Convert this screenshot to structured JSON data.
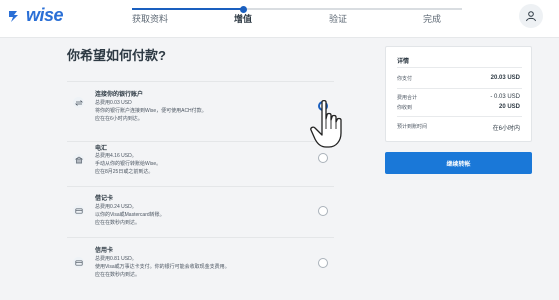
{
  "brand": {
    "logo_text": "wise"
  },
  "steps": [
    {
      "label": "获取资料",
      "active": false
    },
    {
      "label": "增值",
      "active": true
    },
    {
      "label": "验证",
      "active": false
    },
    {
      "label": "完成",
      "active": false
    }
  ],
  "main": {
    "question": "你希望如何付款?",
    "options": [
      {
        "icon": "bank-transfer-icon",
        "title": "连接你的银行账户",
        "lines": [
          "总费用0.03 USD",
          "将你的银行账户连接到Wise，便可使用ACH付款。",
          "应在在6小时内到达。"
        ],
        "selected": true
      },
      {
        "icon": "bank-building-icon",
        "title": "电汇",
        "lines": [
          "总费用4.16 USD。",
          "手动从你的银行转账给Wise。",
          "应在8月25日或之前到达。"
        ],
        "selected": false
      },
      {
        "icon": "debit-card-icon",
        "title": "借记卡",
        "lines": [
          "总费用0.24 USD。",
          "以你的Visa或Mastercard转账。",
          "应在在数秒内到达。"
        ],
        "selected": false
      },
      {
        "icon": "credit-card-icon",
        "title": "信用卡",
        "lines": [
          "总费用0.81 USD。",
          "使用Visa或万事达卡支付。你的银行可能会收取现金支费用。",
          "应在在数秒内到达。"
        ],
        "selected": false
      }
    ]
  },
  "details": {
    "title": "详情",
    "rows": [
      {
        "label": "你支付",
        "value": "20.03 USD",
        "bold": true
      },
      {
        "label": "费用合计",
        "value": "- 0.03 USD",
        "bold": false
      },
      {
        "label": "你收到",
        "value": "20 USD",
        "bold": true
      },
      {
        "label": "预计到账时间",
        "value": "在6小时内",
        "bold": false
      }
    ]
  },
  "cta": {
    "label": "继续转帐"
  },
  "colors": {
    "brand_blue": "#1a5fbf",
    "button_blue": "#1a78d8",
    "logo_blue": "#2a6fd6"
  }
}
